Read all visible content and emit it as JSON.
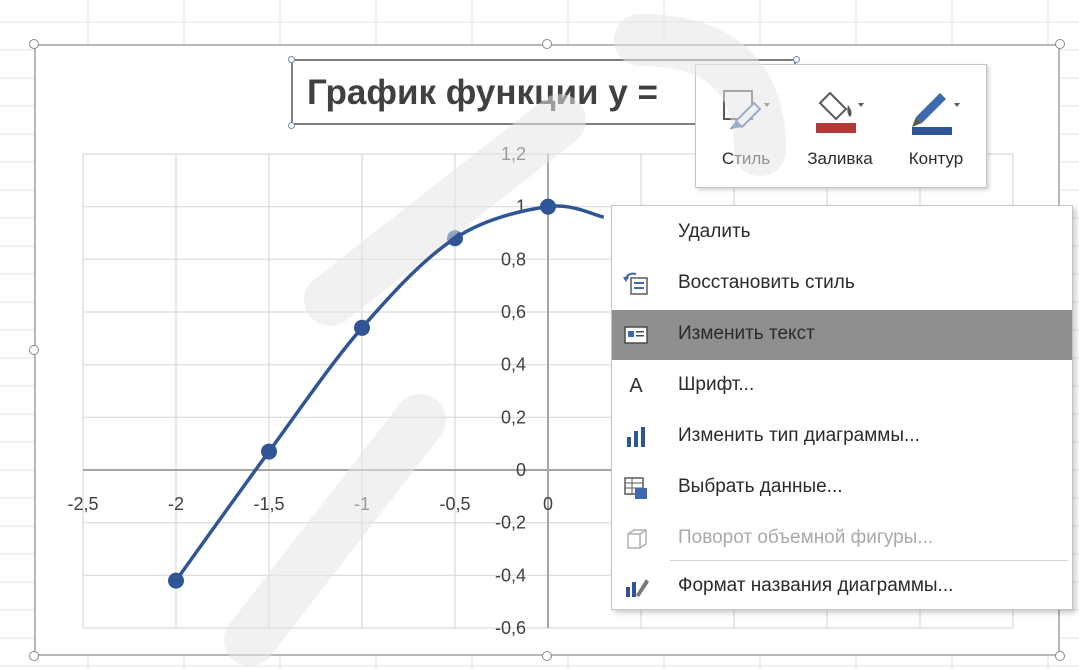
{
  "chart": {
    "title_visible": "График функции у =",
    "colors": {
      "series": "#2f5597",
      "grid": "#d9d9d9",
      "axis": "#a6a6a6"
    }
  },
  "chart_data": {
    "type": "scatter",
    "title": "График функции у =",
    "xlabel": "",
    "ylabel": "",
    "x_ticks": [
      "-2,5",
      "-2",
      "-1,5",
      "-1",
      "-0,5",
      "0"
    ],
    "y_ticks": [
      "1,2",
      "1",
      "0,8",
      "0,6",
      "0,4",
      "0,2",
      "0",
      "-0,2",
      "-0,4",
      "-0,6"
    ],
    "xlim": [
      -2.5,
      2.5
    ],
    "ylim": [
      -0.6,
      1.2
    ],
    "grid": true,
    "smooth_line": true,
    "series": [
      {
        "x": [
          -2,
          -1.5,
          -1,
          -0.5,
          0,
          0.3
        ],
        "y": [
          -0.42,
          0.07,
          0.54,
          0.88,
          1.0,
          0.96
        ]
      }
    ]
  },
  "mini_toolbar": {
    "buttons": [
      {
        "label": "Стиль",
        "icon": "style-icon"
      },
      {
        "label": "Заливка",
        "icon": "fill-bucket-icon"
      },
      {
        "label": "Контур",
        "icon": "outline-pen-icon"
      }
    ]
  },
  "context_menu": {
    "items": [
      {
        "label": "Удалить",
        "icon": "",
        "disabled": false,
        "active": false
      },
      {
        "label": "Восстановить стиль",
        "icon": "reset-style-icon",
        "disabled": false,
        "active": false
      },
      {
        "label": "Изменить текст",
        "icon": "edit-text-icon",
        "disabled": false,
        "active": true
      },
      {
        "label": "Шрифт...",
        "icon": "font-icon",
        "disabled": false,
        "active": false
      },
      {
        "label": "Изменить тип диаграммы...",
        "icon": "chart-type-icon",
        "disabled": false,
        "active": false
      },
      {
        "label": "Выбрать данные...",
        "icon": "select-data-icon",
        "disabled": false,
        "active": false
      },
      {
        "label": "Поворот объемной фигуры...",
        "icon": "3d-rotation-icon",
        "disabled": true,
        "active": false
      },
      {
        "label": "Формат названия диаграммы...",
        "icon": "format-title-icon",
        "disabled": false,
        "active": false
      }
    ]
  }
}
